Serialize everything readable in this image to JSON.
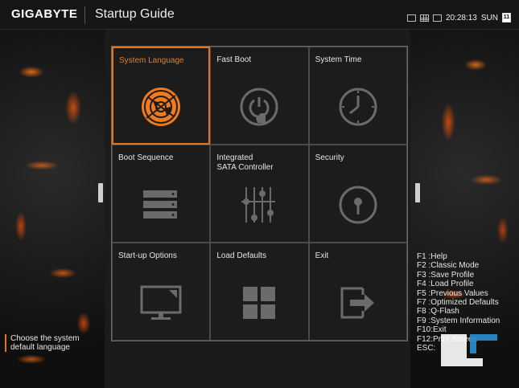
{
  "header": {
    "brand": "GIGABYTE",
    "title": "Startup Guide",
    "time": "20:28:13",
    "day": "SUN",
    "date_day": "11"
  },
  "tiles": [
    {
      "label": "System Language",
      "icon": "globe-icon",
      "active": true
    },
    {
      "label": "Fast Boot",
      "icon": "power-icon",
      "active": false
    },
    {
      "label": "System Time",
      "icon": "clock-icon",
      "active": false
    },
    {
      "label": "Boot Sequence",
      "icon": "drives-icon",
      "active": false
    },
    {
      "label": "Integrated\nSATA Controller",
      "icon": "sliders-icon",
      "active": false
    },
    {
      "label": "Security",
      "icon": "keyhole-icon",
      "active": false
    },
    {
      "label": "Start-up Options",
      "icon": "monitor-icon",
      "active": false
    },
    {
      "label": "Load Defaults",
      "icon": "grid-icon",
      "active": false
    },
    {
      "label": "Exit",
      "icon": "exit-icon",
      "active": false
    }
  ],
  "fkeys": [
    "F1 :Help",
    "F2 :Classic Mode",
    "F3 :Save Profile",
    "F4 :Load Profile",
    "F5 :Previous Values",
    "F7 :Optimized Defaults",
    "F8 :Q-Flash",
    "F9 :System Information",
    "F10:Exit",
    "F12:Print Screen",
    "ESC:"
  ],
  "description": "Choose the system default language",
  "colors": {
    "accent": "#e2741f",
    "background": "#1b1b1b"
  }
}
